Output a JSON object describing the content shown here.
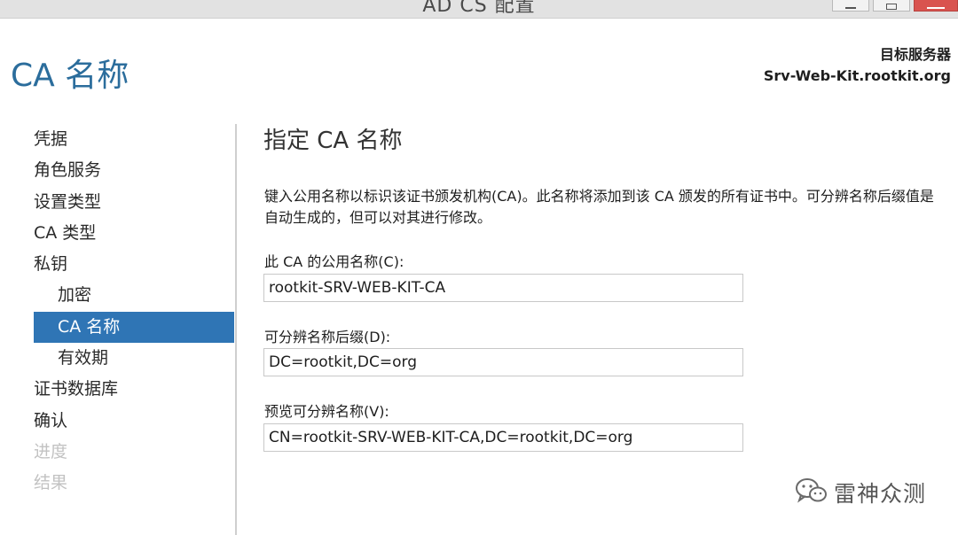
{
  "window": {
    "title": "AD CS 配置"
  },
  "header": {
    "page_title": "CA 名称",
    "target_label": "目标服务器",
    "target_name": "Srv-Web-Kit.rootkit.org"
  },
  "nav": {
    "items": [
      {
        "label": "凭据",
        "state": "normal",
        "level": 0
      },
      {
        "label": "角色服务",
        "state": "normal",
        "level": 0
      },
      {
        "label": "设置类型",
        "state": "normal",
        "level": 0
      },
      {
        "label": "CA 类型",
        "state": "normal",
        "level": 0
      },
      {
        "label": "私钥",
        "state": "normal",
        "level": 0
      },
      {
        "label": "加密",
        "state": "normal",
        "level": 1
      },
      {
        "label": "CA 名称",
        "state": "active",
        "level": 1
      },
      {
        "label": "有效期",
        "state": "normal",
        "level": 1
      },
      {
        "label": "证书数据库",
        "state": "normal",
        "level": 0
      },
      {
        "label": "确认",
        "state": "normal",
        "level": 0
      },
      {
        "label": "进度",
        "state": "disabled",
        "level": 0
      },
      {
        "label": "结果",
        "state": "disabled",
        "level": 0
      }
    ]
  },
  "main": {
    "section_title": "指定 CA 名称",
    "description": "键入公用名称以标识该证书颁发机构(CA)。此名称将添加到该 CA 颁发的所有证书中。可分辨名称后缀值是自动生成的，但可以对其进行修改。",
    "fields": {
      "common_name": {
        "label": "此 CA 的公用名称(C):",
        "value": "rootkit-SRV-WEB-KIT-CA"
      },
      "dn_suffix": {
        "label": "可分辨名称后缀(D):",
        "value": "DC=rootkit,DC=org"
      },
      "preview_dn": {
        "label": "预览可分辨名称(V):",
        "value": "CN=rootkit-SRV-WEB-KIT-CA,DC=rootkit,DC=org"
      }
    }
  },
  "watermark": {
    "text": "雷神众测",
    "icon": "wechat-icon"
  },
  "colors": {
    "accent": "#2f75b5",
    "title": "#2b6d9c"
  }
}
